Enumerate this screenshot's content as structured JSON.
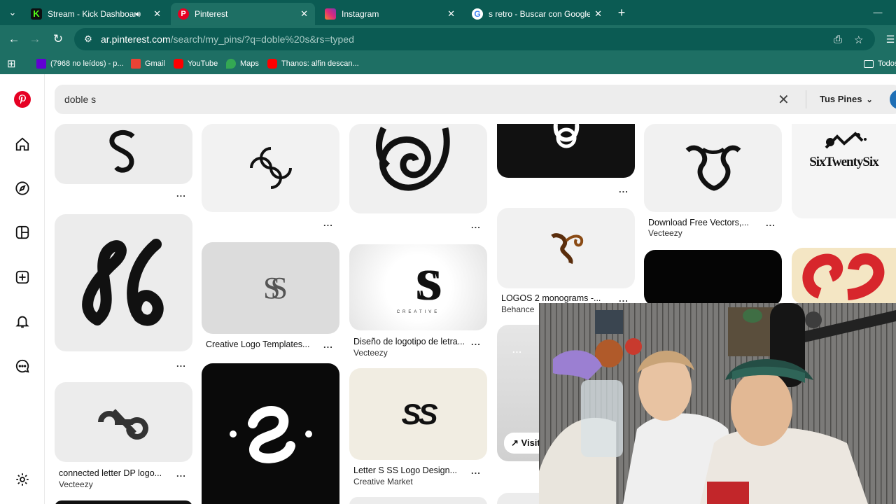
{
  "browser": {
    "tabs": [
      {
        "title": "Stream - Kick Dashboard",
        "favicon": "kick-icon",
        "color": "#53fc18",
        "audio": true
      },
      {
        "title": "Pinterest",
        "favicon": "pinterest-icon",
        "color": "#e60023",
        "active": true
      },
      {
        "title": "Instagram",
        "favicon": "instagram-icon",
        "color": "#dd2a7b"
      },
      {
        "title": "s retro - Buscar con Google",
        "favicon": "google-icon",
        "color": "#4285f4"
      }
    ],
    "new_tab_symbol": "+",
    "minimize_symbol": "—",
    "url_host": "ar.pinterest.com",
    "url_path": "/search/my_pins/?q=doble%20s&rs=typed",
    "bookmarks": [
      {
        "label": "(7968 no leídos) - p...",
        "icon": "yahoo-mail-icon",
        "color": "#6001d2"
      },
      {
        "label": "Gmail",
        "icon": "gmail-icon",
        "color": "#ea4335"
      },
      {
        "label": "YouTube",
        "icon": "youtube-icon",
        "color": "#ff0000"
      },
      {
        "label": "Maps",
        "icon": "maps-icon",
        "color": "#34a853"
      },
      {
        "label": "Thanos: alfin descan...",
        "icon": "youtube-icon",
        "color": "#ff0000"
      }
    ],
    "bookmarks_folder": "Todos"
  },
  "pinterest": {
    "search_query": "doble s",
    "filter_label": "Tus Pines",
    "brand_color": "#e60023",
    "nav": [
      "home-icon",
      "explore-icon",
      "boards-icon",
      "create-icon",
      "notifications-icon",
      "messages-icon",
      "settings-icon"
    ],
    "pins": {
      "c1": [
        {
          "caption": "",
          "source": ""
        },
        {
          "caption": "",
          "source": ""
        },
        {
          "caption": "connected letter DP logo...",
          "source": "Vecteezy"
        }
      ],
      "c2": [
        {
          "caption": "",
          "source": ""
        },
        {
          "caption": "Creative Logo Templates...",
          "source": ""
        },
        {
          "caption": "",
          "source": ""
        }
      ],
      "c3": [
        {
          "caption": "",
          "source": ""
        },
        {
          "caption": "Diseño de logotipo de letra...",
          "source": "Vecteezy"
        },
        {
          "caption": "Letter S SS Logo Design...",
          "source": "Creative Market"
        }
      ],
      "c4": [
        {
          "caption": "",
          "source": ""
        },
        {
          "caption": "LOGOS 2 monograms -...",
          "source": "Behance"
        },
        {
          "caption": "",
          "source": "",
          "visit_label": "Visit"
        }
      ],
      "c5": [
        {
          "caption": "Download Free Vectors,...",
          "source": "Vecteezy"
        },
        {
          "caption": "",
          "source": ""
        }
      ],
      "c6": [
        {
          "caption": "",
          "source": "",
          "brand_text": "SixTwentySix"
        },
        {
          "caption": "",
          "source": ""
        }
      ]
    },
    "logo_texts": {
      "ss_letters": "SS",
      "creative": "CREATIVE",
      "dots": "..."
    }
  }
}
